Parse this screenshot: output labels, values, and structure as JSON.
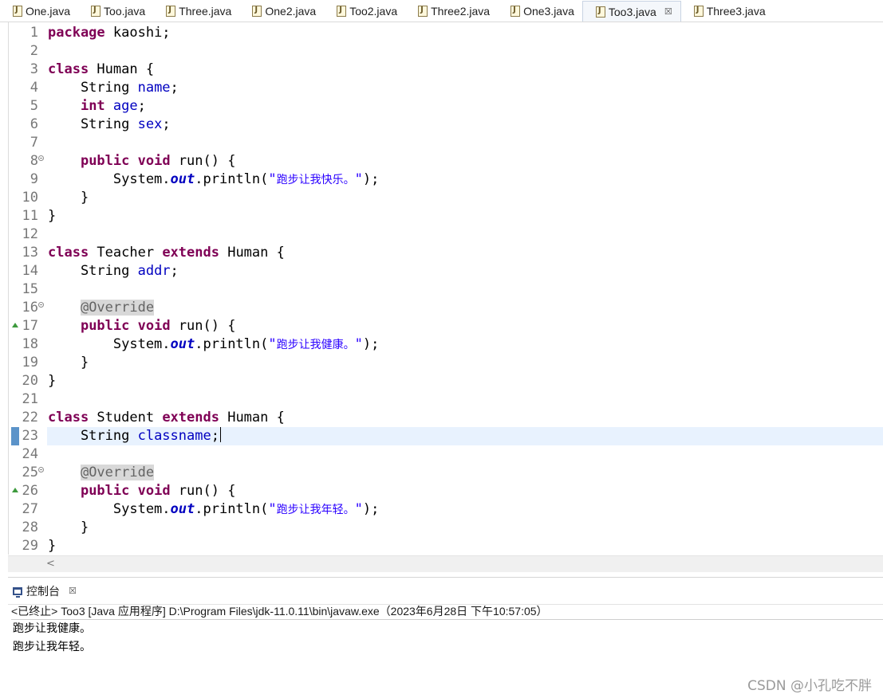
{
  "tabs": [
    {
      "label": "One.java"
    },
    {
      "label": "Too.java"
    },
    {
      "label": "Three.java"
    },
    {
      "label": "One2.java"
    },
    {
      "label": "Too2.java"
    },
    {
      "label": "Three2.java"
    },
    {
      "label": "One3.java"
    },
    {
      "label": "Too3.java",
      "active": true
    },
    {
      "label": "Three3.java"
    }
  ],
  "tab_close_glyph": "☒",
  "editor": {
    "current_line": 23,
    "lines": [
      {
        "n": "1",
        "segs": [
          [
            "kw",
            "package"
          ],
          [
            "t",
            " kaoshi;"
          ]
        ]
      },
      {
        "n": "2",
        "segs": []
      },
      {
        "n": "3",
        "segs": [
          [
            "kw",
            "class"
          ],
          [
            "t",
            " Human {"
          ]
        ]
      },
      {
        "n": "4",
        "segs": [
          [
            "t",
            "    String "
          ],
          [
            "fld",
            "name"
          ],
          [
            "t",
            ";"
          ]
        ]
      },
      {
        "n": "5",
        "segs": [
          [
            "t",
            "    "
          ],
          [
            "kw",
            "int"
          ],
          [
            "t",
            " "
          ],
          [
            "fld",
            "age"
          ],
          [
            "t",
            ";"
          ]
        ]
      },
      {
        "n": "6",
        "segs": [
          [
            "t",
            "    String "
          ],
          [
            "fld",
            "sex"
          ],
          [
            "t",
            ";"
          ]
        ]
      },
      {
        "n": "7",
        "segs": []
      },
      {
        "n": "8",
        "fold": true,
        "segs": [
          [
            "t",
            "    "
          ],
          [
            "kw",
            "public"
          ],
          [
            "t",
            " "
          ],
          [
            "kw",
            "void"
          ],
          [
            "t",
            " run() {"
          ]
        ]
      },
      {
        "n": "9",
        "segs": [
          [
            "t",
            "        System."
          ],
          [
            "sfld",
            "out"
          ],
          [
            "t",
            ".println("
          ],
          [
            "str",
            "\""
          ],
          [
            "strcn",
            "跑步让我快乐。"
          ],
          [
            "str",
            "\""
          ],
          [
            "t",
            ");"
          ]
        ]
      },
      {
        "n": "10",
        "segs": [
          [
            "t",
            "    }"
          ]
        ]
      },
      {
        "n": "11",
        "segs": [
          [
            "t",
            "}"
          ]
        ]
      },
      {
        "n": "12",
        "segs": []
      },
      {
        "n": "13",
        "segs": [
          [
            "kw",
            "class"
          ],
          [
            "t",
            " Teacher "
          ],
          [
            "kw",
            "extends"
          ],
          [
            "t",
            " Human {"
          ]
        ]
      },
      {
        "n": "14",
        "segs": [
          [
            "t",
            "    String "
          ],
          [
            "fld",
            "addr"
          ],
          [
            "t",
            ";"
          ]
        ]
      },
      {
        "n": "15",
        "segs": []
      },
      {
        "n": "16",
        "fold": true,
        "segs": [
          [
            "t",
            "    "
          ],
          [
            "ann",
            "@Override"
          ]
        ]
      },
      {
        "n": "17",
        "override": true,
        "segs": [
          [
            "t",
            "    "
          ],
          [
            "kw",
            "public"
          ],
          [
            "t",
            " "
          ],
          [
            "kw",
            "void"
          ],
          [
            "t",
            " run() {"
          ]
        ]
      },
      {
        "n": "18",
        "segs": [
          [
            "t",
            "        System."
          ],
          [
            "sfld",
            "out"
          ],
          [
            "t",
            ".println("
          ],
          [
            "str",
            "\""
          ],
          [
            "strcn",
            "跑步让我健康。"
          ],
          [
            "str",
            "\""
          ],
          [
            "t",
            ");"
          ]
        ]
      },
      {
        "n": "19",
        "segs": [
          [
            "t",
            "    }"
          ]
        ]
      },
      {
        "n": "20",
        "segs": [
          [
            "t",
            "}"
          ]
        ]
      },
      {
        "n": "21",
        "segs": []
      },
      {
        "n": "22",
        "segs": [
          [
            "kw",
            "class"
          ],
          [
            "t",
            " Student "
          ],
          [
            "kw",
            "extends"
          ],
          [
            "t",
            " Human {"
          ]
        ]
      },
      {
        "n": "23",
        "bookmark": true,
        "segs": [
          [
            "t",
            "    String "
          ],
          [
            "fld",
            "classname"
          ],
          [
            "t",
            ";"
          ],
          [
            "caret",
            ""
          ]
        ]
      },
      {
        "n": "24",
        "segs": []
      },
      {
        "n": "25",
        "fold": true,
        "segs": [
          [
            "t",
            "    "
          ],
          [
            "ann",
            "@Override"
          ]
        ]
      },
      {
        "n": "26",
        "override": true,
        "segs": [
          [
            "t",
            "    "
          ],
          [
            "kw",
            "public"
          ],
          [
            "t",
            " "
          ],
          [
            "kw",
            "void"
          ],
          [
            "t",
            " run() {"
          ]
        ]
      },
      {
        "n": "27",
        "segs": [
          [
            "t",
            "        System."
          ],
          [
            "sfld",
            "out"
          ],
          [
            "t",
            ".println("
          ],
          [
            "str",
            "\""
          ],
          [
            "strcn",
            "跑步让我年轻。"
          ],
          [
            "str",
            "\""
          ],
          [
            "t",
            ");"
          ]
        ]
      },
      {
        "n": "28",
        "segs": [
          [
            "t",
            "    }"
          ]
        ]
      },
      {
        "n": "29",
        "segs": [
          [
            "t",
            "}"
          ]
        ]
      }
    ]
  },
  "scroll_left_glyph": "<",
  "console": {
    "tab_label": "控制台",
    "close_glyph": "☒",
    "status": "<已终止> Too3 [Java 应用程序] D:\\Program Files\\jdk-11.0.11\\bin\\javaw.exe（2023年6月28日 下午10:57:05）",
    "output": [
      "跑步让我健康。",
      "跑步让我年轻。"
    ]
  },
  "watermark": "CSDN @小孔吃不胖"
}
